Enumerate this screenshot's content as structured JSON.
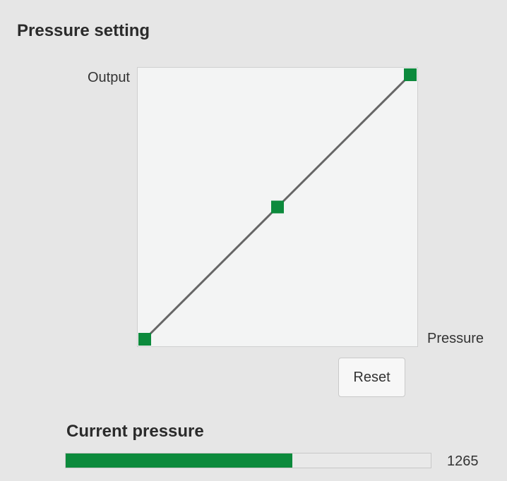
{
  "pressure_setting": {
    "title": "Pressure setting",
    "y_axis_label": "Output",
    "x_axis_label": "Pressure",
    "reset_label": "Reset",
    "curve_color": "#666666",
    "point_color": "#0c8a3c",
    "control_points": [
      {
        "pressure": 0.0,
        "output": 0.0
      },
      {
        "pressure": 0.5,
        "output": 0.5
      },
      {
        "pressure": 1.0,
        "output": 1.0
      }
    ]
  },
  "current_pressure": {
    "title": "Current pressure",
    "value": "1265",
    "fraction": 0.62,
    "bar_color": "#0c8a3c"
  }
}
